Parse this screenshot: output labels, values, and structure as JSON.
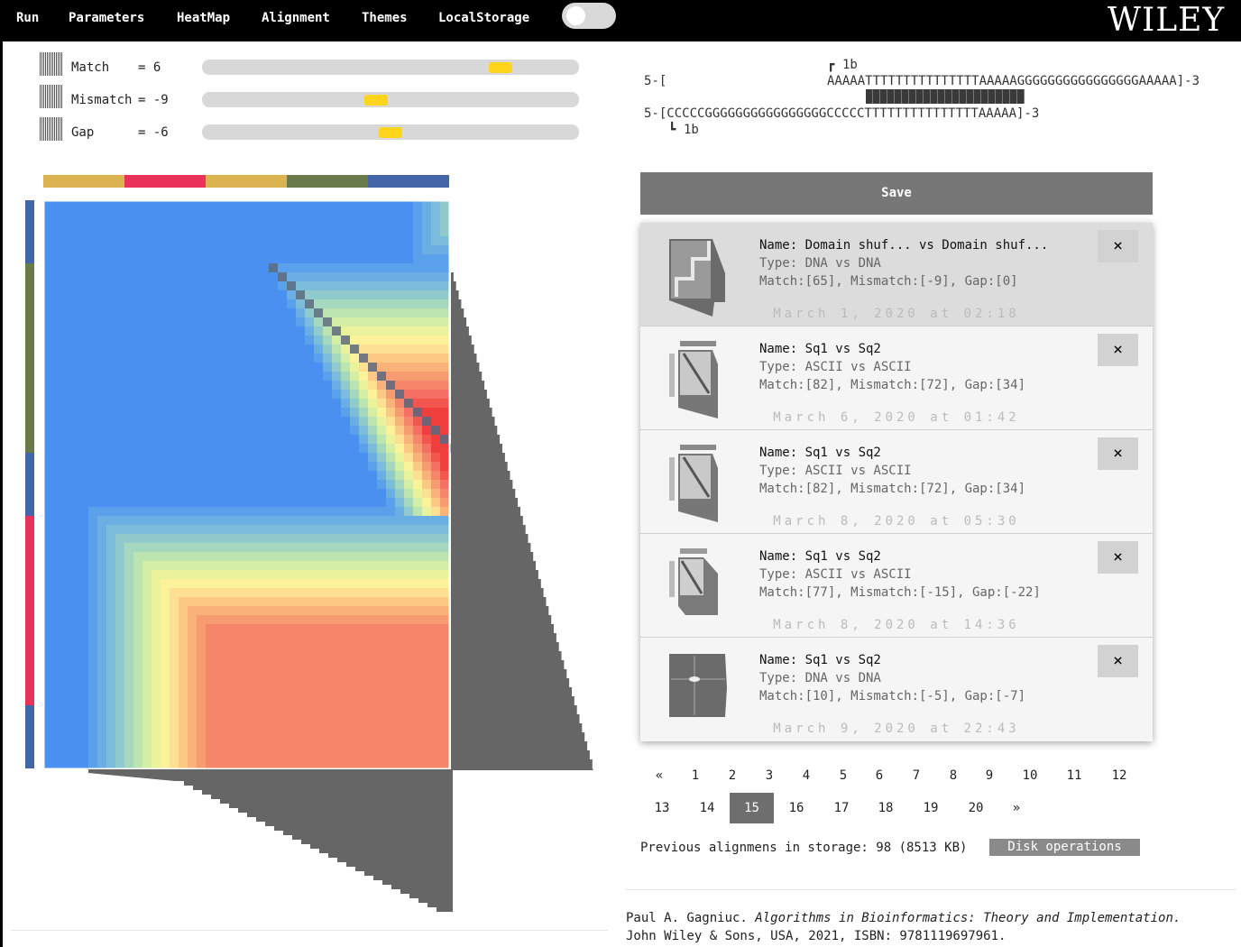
{
  "nav": {
    "items": [
      "Run",
      "Parameters",
      "HeatMap",
      "Alignment",
      "Themes",
      "LocalStorage"
    ],
    "logo": "WILEY"
  },
  "params": [
    {
      "label": "Match",
      "value": "= 6",
      "level": 0.81
    },
    {
      "label": "Mismatch",
      "value": "= -9",
      "level": 0.46
    },
    {
      "label": "Gap",
      "value": "= -6",
      "level": 0.5
    }
  ],
  "heatmap": {
    "top_colors": [
      "#dbb451",
      "#e8325a",
      "#dbb451",
      "#6a7b4b",
      "#4466a8"
    ],
    "left_colors": [
      "#4466a8",
      "#6a7b4b",
      "#4466a8",
      "#e8325a",
      "#4466a8"
    ]
  },
  "alignment": {
    "marker_top": "1b",
    "marker_bottom": "1b",
    "seq1_prefix": "5-[",
    "seq1": "AAAAATTTTTTTTTTTTTTTAAAAAGGGGGGGGGGGGGGGGAAAAA]-3",
    "seq2": "5-[CCCCCGGGGGGGGGGGGGGGGCCCCCTTTTTTTTTTTTTTTAAAAA]-3"
  },
  "save_label": "Save",
  "saved": [
    {
      "name": "Name: Domain shuf... vs Domain shuf...",
      "type": "Type: DNA vs DNA",
      "scores": "Match:[65], Mismatch:[-9], Gap:[0]",
      "date": "March 1, 2020 at 02:18",
      "selected": true
    },
    {
      "name": "Name: Sq1 vs Sq2",
      "type": "Type: ASCII vs ASCII",
      "scores": "Match:[82], Mismatch:[72], Gap:[34]",
      "date": "March 6, 2020 at 01:42",
      "selected": false
    },
    {
      "name": "Name: Sq1 vs Sq2",
      "type": "Type: ASCII vs ASCII",
      "scores": "Match:[82], Mismatch:[72], Gap:[34]",
      "date": "March 8, 2020 at 05:30",
      "selected": false
    },
    {
      "name": "Name: Sq1 vs Sq2",
      "type": "Type: ASCII vs ASCII",
      "scores": "Match:[77], Mismatch:[-15], Gap:[-22]",
      "date": "March 8, 2020 at 14:36",
      "selected": false
    },
    {
      "name": "Name: Sq1 vs Sq2",
      "type": "Type: DNA vs DNA",
      "scores": "Match:[10], Mismatch:[-5], Gap:[-7]",
      "date": "March 9, 2020 at 22:43",
      "selected": false
    }
  ],
  "delete_label": "×",
  "pagination": {
    "prev": "«",
    "next": "»",
    "pages": [
      "1",
      "2",
      "3",
      "4",
      "5",
      "6",
      "7",
      "8",
      "9",
      "10",
      "11",
      "12",
      "13",
      "14",
      "15",
      "16",
      "17",
      "18",
      "19",
      "20"
    ],
    "current": "15"
  },
  "storage_text": "Previous alignmens in storage: 98 (8513 KB)",
  "disk_label": "Disk operations",
  "citation": {
    "author": "Paul A. Gagniuc. ",
    "title": "Algorithms in Bioinformatics: Theory and Implementation.",
    "rest": "John Wiley & Sons, USA, 2021, ISBN: 9781119697961."
  }
}
